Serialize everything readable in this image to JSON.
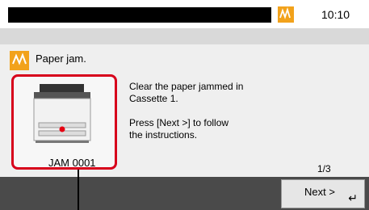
{
  "status": {
    "time": "10:10"
  },
  "message": {
    "title": "Paper jam.",
    "image_label": "JAM 0001",
    "line1": "Clear the paper jammed in",
    "line2": "Cassette 1.",
    "line3": "Press [Next >] to follow",
    "line4": "the instructions."
  },
  "pagination": {
    "counter": "1/3"
  },
  "actions": {
    "next_label": "Next >"
  },
  "icons": {
    "alert": "paper-jam-icon",
    "enter": "enter-icon"
  },
  "colors": {
    "alert": "#f2a21b",
    "highlight": "#d7001b",
    "footer": "#4a4a4a"
  }
}
